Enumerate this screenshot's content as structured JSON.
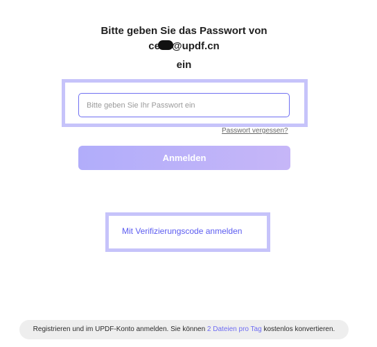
{
  "heading": {
    "line1": "Bitte geben Sie das Passwort von",
    "email_prefix": "ce",
    "email_suffix": "@updf.cn",
    "line3": "ein"
  },
  "password": {
    "value": "",
    "placeholder": "Bitte geben Sie Ihr Passwort ein"
  },
  "forgot_label": "Passwort vergessen?",
  "login_label": "Anmelden",
  "verify_label": "Mit Verifizierungscode anmelden",
  "footer": {
    "before": "Registrieren und im UPDF-Konto anmelden. Sie können ",
    "link": "2 Dateien pro Tag",
    "after": " kostenlos konvertieren."
  },
  "colors": {
    "accent": "#6f6ff1",
    "highlight": "#c6c3fa",
    "button_gradient_start": "#b1adfa",
    "button_gradient_end": "#c6b6f8"
  }
}
